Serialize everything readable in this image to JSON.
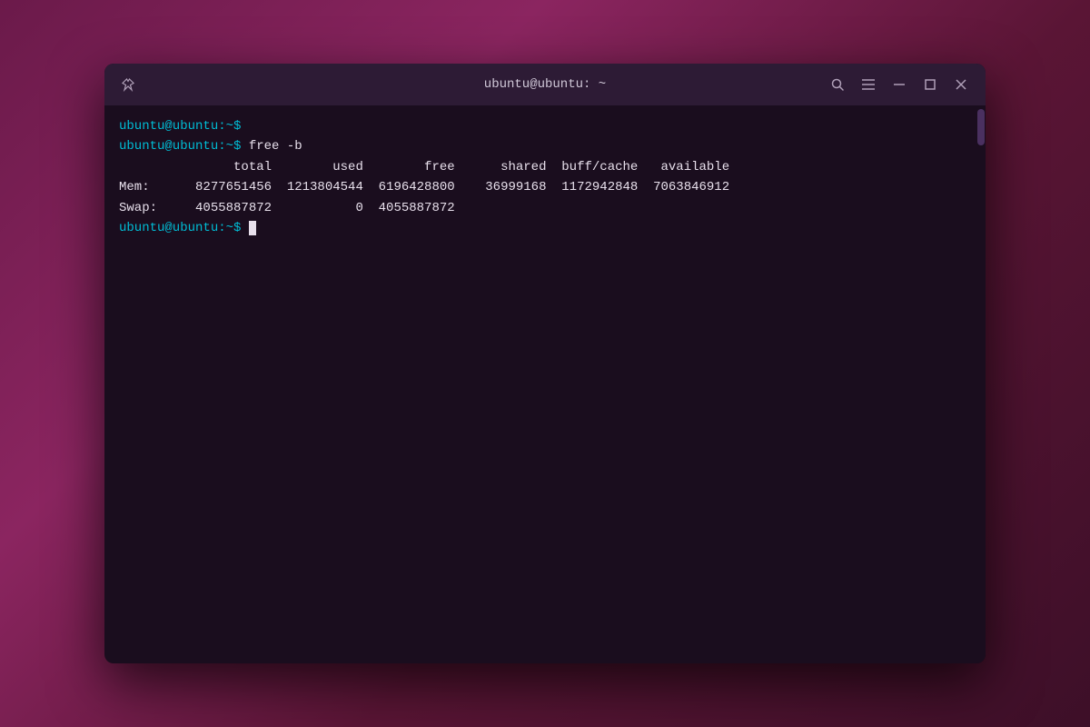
{
  "window": {
    "title": "ubuntu@ubuntu: ~",
    "titlebar": {
      "pin_icon": "📌",
      "search_icon": "🔍",
      "menu_icon": "☰",
      "minimize_icon": "–",
      "maximize_icon": "□",
      "close_icon": "✕"
    }
  },
  "terminal": {
    "lines": [
      {
        "type": "prompt",
        "prompt": "ubuntu@ubuntu:~$",
        "command": ""
      },
      {
        "type": "prompt",
        "prompt": "ubuntu@ubuntu:~$",
        "command": " free  -b"
      },
      {
        "type": "header",
        "text": "               total        used        free      shared  buff/cache   available"
      },
      {
        "type": "data",
        "text": "Mem:      8277651456  1213804544  6196428800    36999168  1172942848  7063846912"
      },
      {
        "type": "data",
        "text": "Swap:     4055887872           0  4055887872"
      },
      {
        "type": "prompt_cursor",
        "prompt": "ubuntu@ubuntu:~$",
        "command": ""
      }
    ]
  }
}
